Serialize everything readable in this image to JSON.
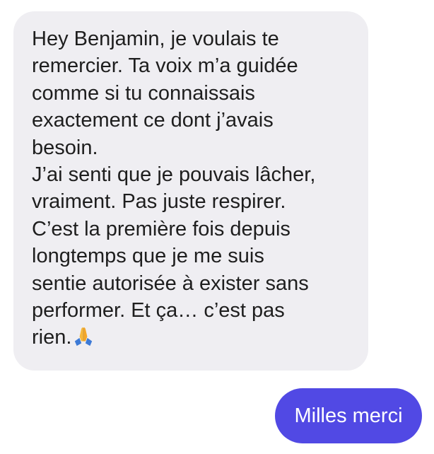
{
  "colors": {
    "incoming_bubble": "#efeef2",
    "incoming_text": "#1e1e1e",
    "outgoing_bubble": "#5149e4",
    "outgoing_text": "#ffffff"
  },
  "incoming_message": {
    "lines": [
      "Hey Benjamin, je voulais te",
      "remercier. Ta voix m’a guidée",
      "comme si tu connaissais",
      "exactement ce dont j’avais",
      "besoin.",
      "J’ai senti que je pouvais lâcher,",
      "vraiment. Pas juste respirer.",
      "C’est la première fois depuis",
      "longtemps que je me suis",
      "sentie autorisée à exister sans",
      "performer. Et ça… c’est pas",
      "rien."
    ],
    "trailing_emoji": "praying-hands-icon"
  },
  "outgoing_message": {
    "text": "Milles merci"
  }
}
